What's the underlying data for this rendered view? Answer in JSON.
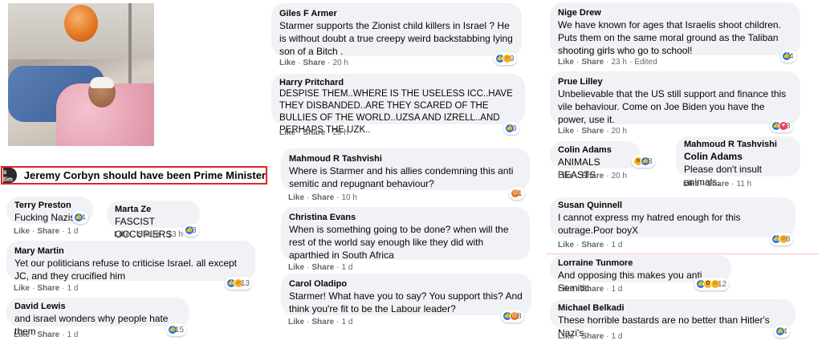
{
  "headline": {
    "avatar_text": "s tim",
    "text": "Jeremy Corbyn should have been Prime Minister"
  },
  "labels": {
    "like": "Like",
    "share": "Share",
    "dot": "·"
  },
  "comments": [
    {
      "name": "Terry Preston",
      "text": "Fucking Nazis",
      "time": "1 d",
      "count": "4",
      "reacts": [
        "like-icon"
      ]
    },
    {
      "name": "Marta Ze",
      "text": "FASCIST OCCUPIERS",
      "time": "13 h",
      "count": "3",
      "reacts": [
        "like-icon"
      ]
    },
    {
      "name": "Mary Martin",
      "text": "Yet our politicians refuse to criticise Israel. all except JC, and they crucified him",
      "time": "1 d",
      "count": "13",
      "reacts": [
        "like-icon",
        "care-icon"
      ]
    },
    {
      "name": "David Lewis",
      "text": "and israel wonders why people hate them",
      "time": "1 d",
      "count": "15",
      "reacts": [
        "like-icon"
      ]
    },
    {
      "name": "Giles F Armer",
      "text": "Starmer supports the Zionist child killers in Israel ? He is without doubt a true creepy weird backstabbing lying son of a Bitch .",
      "time": "20 h",
      "count": "3",
      "reacts": [
        "like-icon",
        "care-icon"
      ]
    },
    {
      "name": "Harry Pritchard",
      "text": "DESPISE THEM..WHERE IS THE USELESS ICC..HAVE THEY DISBANDED..ARE THEY SCARED OF THE BULLIES OF THE WORLD..UZSA AND IZRELL..AND PERHAPS THE UZK..",
      "time": "20 h",
      "count": "3",
      "reacts": [
        "like-icon"
      ]
    },
    {
      "name": "Mahmoud R Tashvishi",
      "text": "Where is Starmer and his allies condemning this anti semitic and repugnant behaviour?",
      "time": "10 h",
      "count": "1",
      "reacts": [
        "angry-icon"
      ]
    },
    {
      "name": "Christina Evans",
      "text": "When is something going to be done? when will the rest of the world say enough like they did with aparthied in South Africa",
      "time": "1 d",
      "count": "",
      "reacts": []
    },
    {
      "name": "Carol Oladipo",
      "text": "Starmer! What have you to say? You support this? And think you're fit to be the Labour leader?",
      "time": "1 d",
      "count": "8",
      "reacts": [
        "like-icon",
        "angry-icon"
      ]
    },
    {
      "name": "Nige Drew",
      "text": "We have known for ages that Israelis shoot children. Puts them on the same moral ground as the Taliban shooting girls who go to school!",
      "time": "23 h",
      "edited": "Edited",
      "count": "4",
      "reacts": [
        "like-icon"
      ]
    },
    {
      "name": "Prue Lilley",
      "text": "Unbelievable that the US still support and finance this vile behaviour. Come on Joe Biden you have the power, use it.",
      "time": "20 h",
      "count": "3",
      "reacts": [
        "like-icon",
        "heart-icon"
      ]
    },
    {
      "name": "Colin Adams",
      "text": "ANIMALS BEASTS",
      "time": "20 h",
      "count": "3",
      "reacts": [
        "wow-icon",
        "like-icon"
      ]
    },
    {
      "name": "Mahmoud R Tashvishi",
      "subname": "Colin Adams",
      "text": "Please don't insult animals.",
      "time": "11 h",
      "count": "",
      "reacts": []
    },
    {
      "name": "Susan Quinnell",
      "text": "I cannot express my hatred enough for this outrage.Poor boyX",
      "time": "1 d",
      "count": "8",
      "reacts": [
        "like-icon",
        "care-icon"
      ]
    },
    {
      "name": "Lorraine Tunmore",
      "text": "And opposing this makes you anti Semitic",
      "time": "1 d",
      "count": "12",
      "reacts": [
        "like-icon",
        "haha-icon",
        "care-icon"
      ]
    },
    {
      "name": "Michael Belkadi",
      "text": "These horrible bastards are no better than Hitler's Nazi's.",
      "time": "1 d",
      "count": "4",
      "reacts": [
        "like-icon"
      ]
    }
  ],
  "colors": {
    "bubble": "#f0f2f5",
    "meta": "#65676b",
    "like": "#1877f2",
    "highlight_border": "#e02424"
  }
}
